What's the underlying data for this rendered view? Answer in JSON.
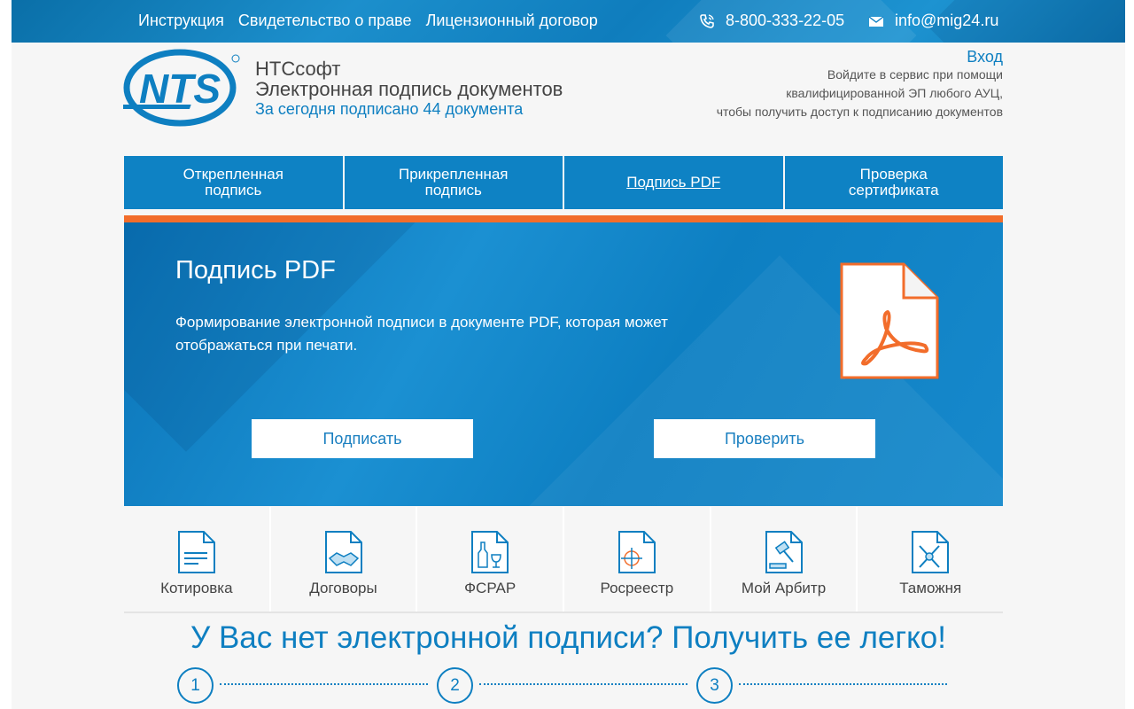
{
  "topbar": {
    "links": [
      "Инструкция",
      "Свидетельство о праве",
      "Лицензионный договор"
    ],
    "phone": "8-800-333-22-05",
    "email": "info@mig24.ru"
  },
  "header": {
    "brand_name": "НТСсофт",
    "brand_subtitle": "Электронная подпись документов",
    "signed_today": "За сегодня подписано 44 документа",
    "login_link": "Вход",
    "login_hint_1": "Войдите в сервис при помощи",
    "login_hint_2": "квалифицированной ЭП любого АУЦ,",
    "login_hint_3": "чтобы получить доступ к подписанию документов"
  },
  "tabs": [
    {
      "label": "Открепленная подпись"
    },
    {
      "label": "Прикрепленная подпись"
    },
    {
      "label": "Подпись PDF"
    },
    {
      "label": "Проверка сертификата"
    }
  ],
  "hero": {
    "title": "Подпись PDF",
    "description": "Формирование электронной подписи в документе PDF, которая может отображаться при печати.",
    "sign_button": "Подписать",
    "verify_button": "Проверить"
  },
  "services": [
    {
      "label": "Котировка",
      "icon": "document-lines-icon"
    },
    {
      "label": "Договоры",
      "icon": "handshake-document-icon"
    },
    {
      "label": "ФСРАР",
      "icon": "bottle-glass-document-icon"
    },
    {
      "label": "Росреестр",
      "icon": "map-document-icon"
    },
    {
      "label": "Мой Арбитр",
      "icon": "gavel-document-icon"
    },
    {
      "label": "Таможня",
      "icon": "customs-document-icon"
    }
  ],
  "promo": {
    "headline": "У Вас нет электронной подписи? Получить ее легко!",
    "steps": [
      "1",
      "2",
      "3"
    ]
  },
  "colors": {
    "accent": "#0e7fc1",
    "orange": "#f26d2b",
    "tab_bg": "#0e82c4"
  }
}
